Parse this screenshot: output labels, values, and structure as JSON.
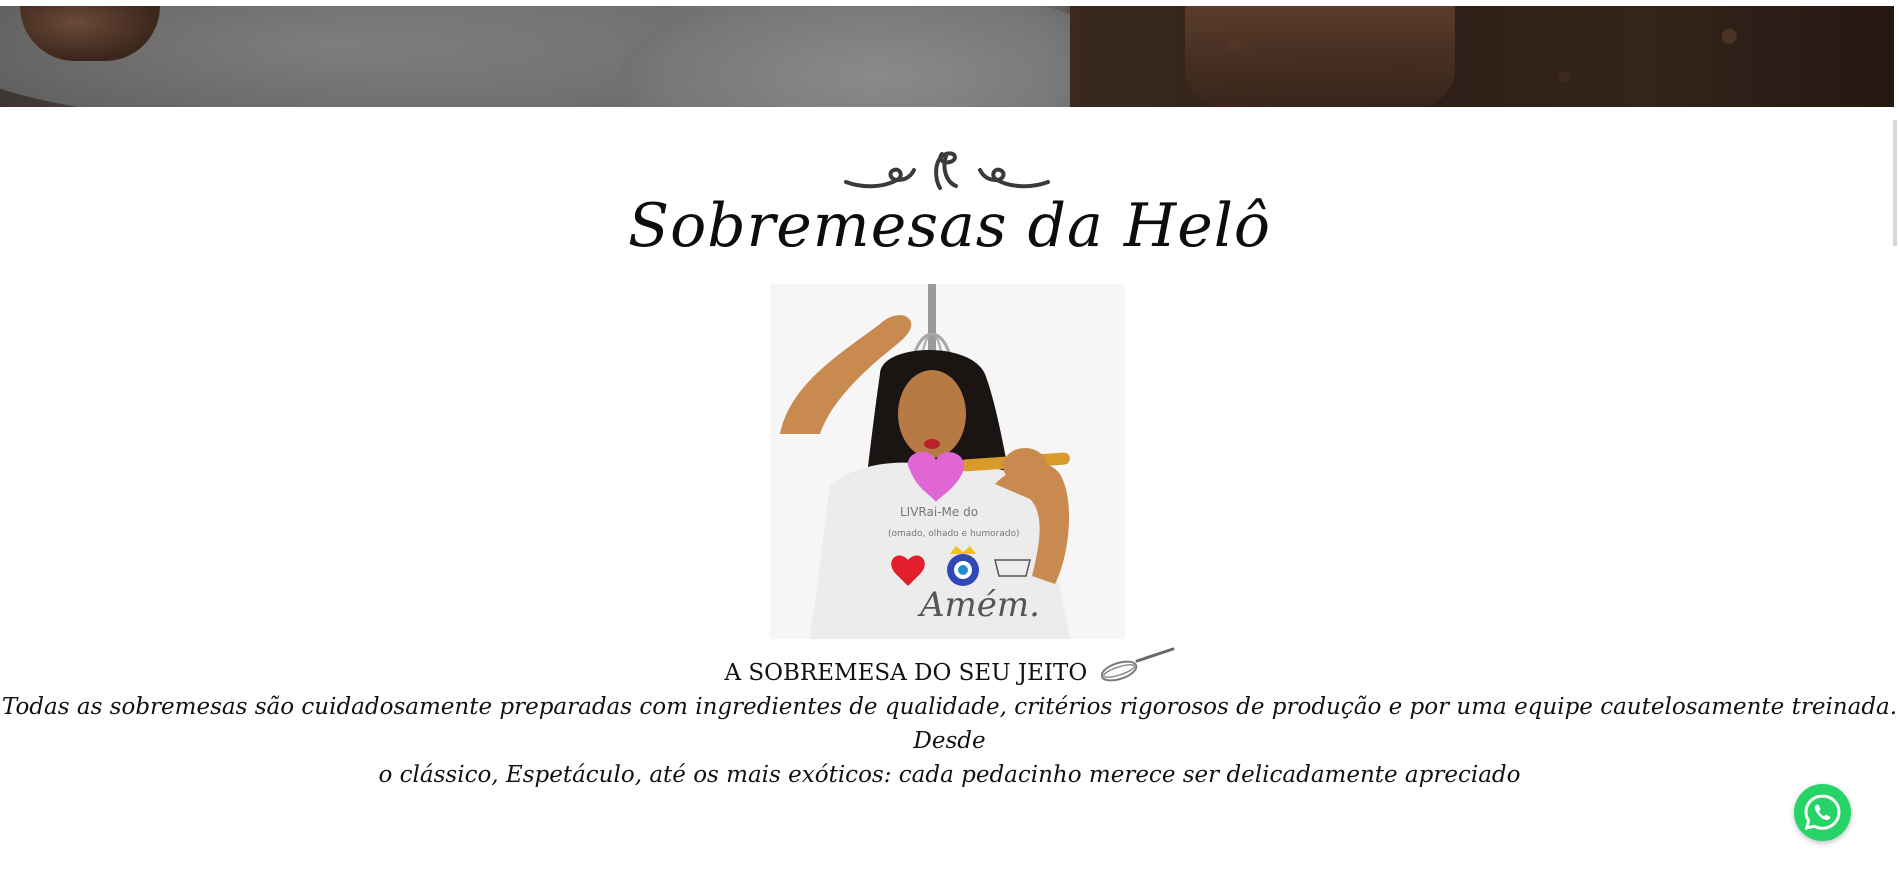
{
  "header": {
    "brand_title": "Sobremesas da Helô"
  },
  "hero": {
    "image_description_icon": "dessert-banner-image"
  },
  "portrait": {
    "shirt_text_line1": "LIVRai-Me do",
    "shirt_text_line2": "(omado, olhado e humorado)",
    "shirt_text_line3": "Amém."
  },
  "intro": {
    "tagline": "A SOBREMESA DO SEU JEITO",
    "description_line1": "Todas as sobremesas são cuidadosamente preparadas com ingredientes de qualidade, critérios rigorosos de produção e por uma equipe cautelosamente treinada. Desde",
    "description_line2": "o clássico, Espetáculo, até os mais exóticos: cada pedacinho merece ser delicadamente apreciado"
  },
  "floating": {
    "whatsapp_icon": "whatsapp-icon",
    "whatsapp_color": "#25d366"
  },
  "colors": {
    "text": "#111111",
    "background": "#ffffff",
    "banner_dark": "#2c1f17"
  }
}
